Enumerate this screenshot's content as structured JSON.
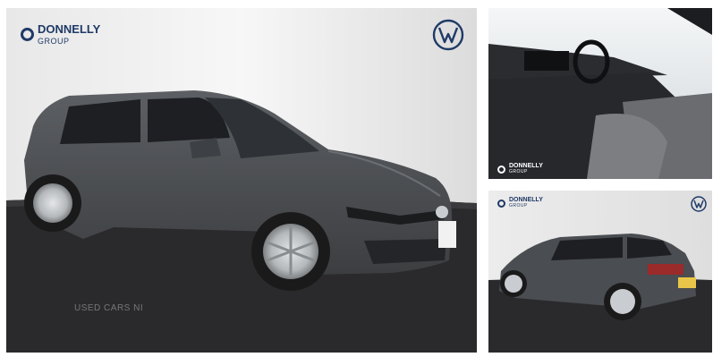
{
  "dealer": {
    "name": "DONNELLY",
    "sub": "GROUP"
  },
  "brand_badge": "vw-logo-icon",
  "watermark": "USED CARS NI",
  "photos": [
    {
      "id": "exterior-front-three-quarter"
    },
    {
      "id": "interior-front-cabin"
    },
    {
      "id": "exterior-rear-three-quarter"
    }
  ],
  "colors": {
    "brand_navy": "#1f3a67",
    "car_grey": "#4a4d51",
    "floor": "#2a2a2c"
  }
}
